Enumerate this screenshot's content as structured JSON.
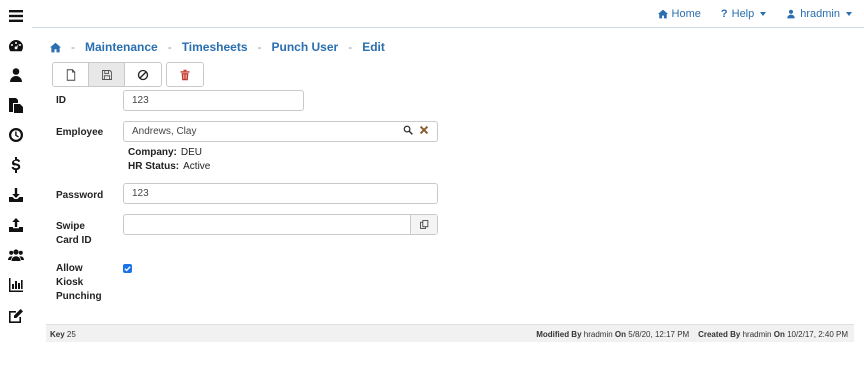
{
  "sidebar": {
    "icons": [
      "menu-icon",
      "dashboard-icon",
      "user-icon",
      "documents-icon",
      "clock-icon",
      "dollar-icon",
      "download-icon",
      "upload-icon",
      "users-icon",
      "chart-icon",
      "edit-icon"
    ]
  },
  "topnav": {
    "home": "Home",
    "help": "Help",
    "user": "hradmin"
  },
  "breadcrumb": {
    "items": [
      "Maintenance",
      "Timesheets",
      "Punch User",
      "Edit"
    ],
    "separator": "-"
  },
  "form": {
    "id_label": "ID",
    "id_value": "123",
    "employee_label": "Employee",
    "employee_value": "Andrews, Clay",
    "company_label": "Company:",
    "company_value": "DEU",
    "hr_status_label": "HR Status:",
    "hr_status_value": "Active",
    "password_label": "Password",
    "password_value": "123",
    "swipe_label_1": "Swipe",
    "swipe_label_2": "Card ID",
    "swipe_value": "",
    "kiosk_label_1": "Allow",
    "kiosk_label_2": "Kiosk",
    "kiosk_label_3": "Punching",
    "kiosk_checked": true
  },
  "footer": {
    "key_label": "Key",
    "key_value": "25",
    "modified_label": "Modified By",
    "modified_user": "hradmin",
    "on_label": "On",
    "modified_on": "5/8/20, 12:17 PM",
    "created_label": "Created By",
    "created_user": "hradmin",
    "created_on": "10/2/17, 2:40 PM"
  },
  "colors": {
    "accent": "#2a6fb0",
    "delete": "#c0392b",
    "checkbox": "#1a73e8"
  }
}
